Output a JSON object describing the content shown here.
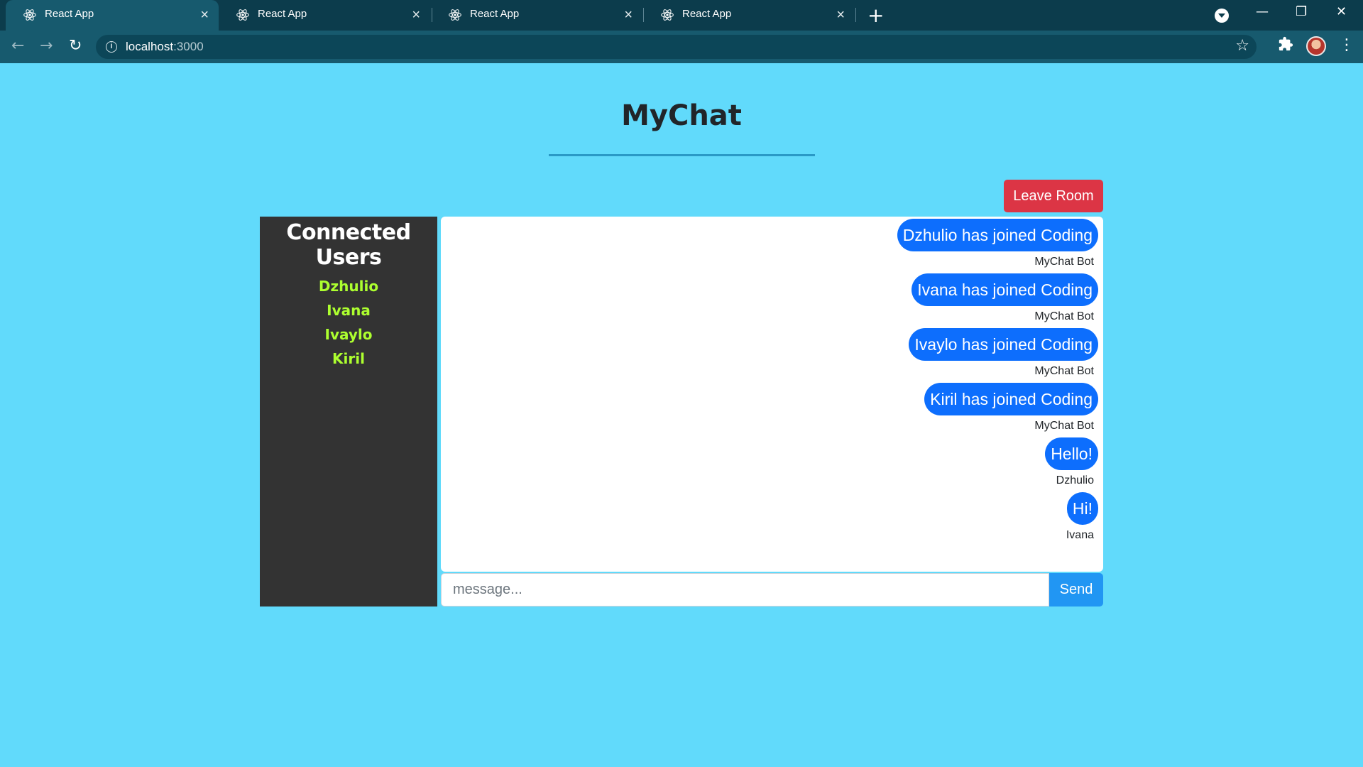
{
  "browser": {
    "tabs": [
      {
        "title": "React App",
        "active": true
      },
      {
        "title": "React App",
        "active": false
      },
      {
        "title": "React App",
        "active": false
      },
      {
        "title": "React App",
        "active": false
      }
    ],
    "url_host": "localhost",
    "url_port": ":3000",
    "icons": {
      "favicon": "react-logo-icon",
      "new_tab": "+",
      "back": "←",
      "forward": "→",
      "reload": "↻",
      "star": "☆",
      "extensions": "puzzle-icon",
      "menu": "⋮"
    }
  },
  "app": {
    "title": "MyChat",
    "leave_label": "Leave Room",
    "users_heading": "Connected Users",
    "users": [
      "Dzhulio",
      "Ivana",
      "Ivaylo",
      "Kiril"
    ],
    "messages": [
      {
        "text": "Dzhulio has joined Coding",
        "user": "MyChat Bot"
      },
      {
        "text": "Ivana has joined Coding",
        "user": "MyChat Bot"
      },
      {
        "text": "Ivaylo has joined Coding",
        "user": "MyChat Bot"
      },
      {
        "text": "Kiril has joined Coding",
        "user": "MyChat Bot"
      },
      {
        "text": "Hello!",
        "user": "Dzhulio"
      },
      {
        "text": "Hi!",
        "user": "Ivana"
      }
    ],
    "input_placeholder": "message...",
    "send_label": "Send",
    "colors": {
      "background": "#61dafb",
      "leave": "#dc3545",
      "bubble": "#0d6efd",
      "user_name": "#adff2f",
      "send": "#2196f3"
    }
  }
}
